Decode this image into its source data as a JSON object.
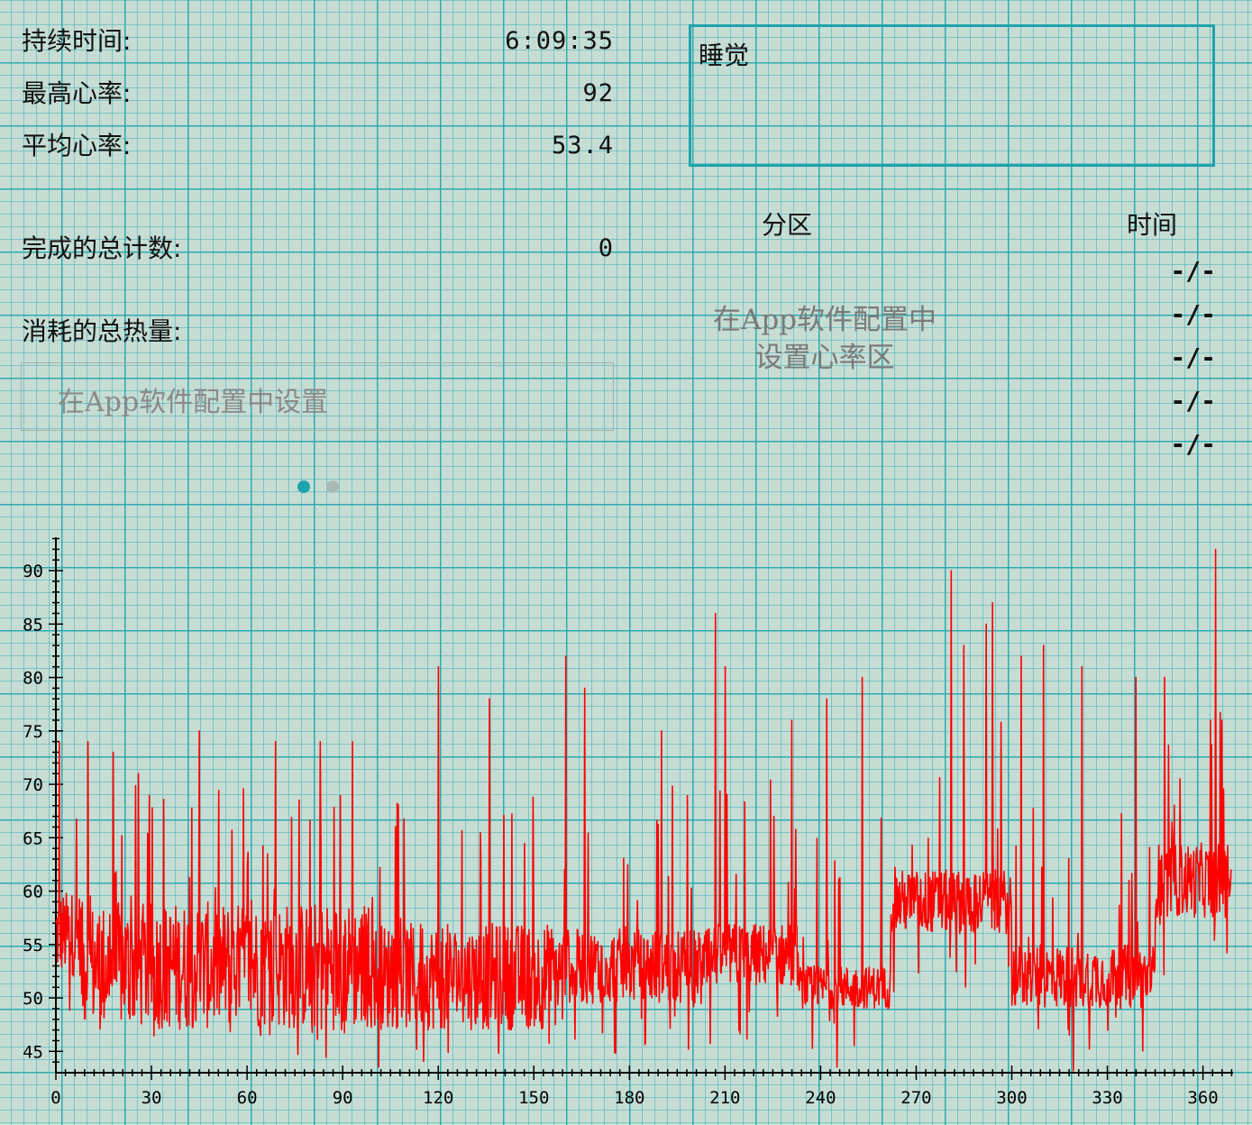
{
  "stats": {
    "duration_label": "持续时间:",
    "duration_value": "6:09:35",
    "max_hr_label": "最高心率:",
    "max_hr_value": "92",
    "avg_hr_label": "平均心率:",
    "avg_hr_value": "53.4",
    "total_count_label": "完成的总计数:",
    "total_count_value": "0",
    "calories_label": "消耗的总热量:"
  },
  "calories_config": {
    "text": "在App软件配置中设置"
  },
  "activity": {
    "mode": "睡觉"
  },
  "zones": {
    "header_zone": "分区",
    "header_time": "时间",
    "message_line1": "在App软件配置中",
    "message_line2": "设置心率区",
    "times": [
      "-/-",
      "-/-",
      "-/-",
      "-/-",
      "-/-"
    ]
  },
  "pager": {
    "pages": 2,
    "active": 0,
    "active_color": "#1fa3ad",
    "inactive_color": "#a9b9b3"
  },
  "chart_data": {
    "type": "line",
    "series": [
      {
        "color": "#ff0000",
        "x_range": [
          0,
          370
        ],
        "baseline": 53.4,
        "max": 92,
        "min": 43
      }
    ],
    "x_ticks": [
      0,
      30,
      60,
      90,
      120,
      150,
      180,
      210,
      240,
      270,
      300,
      330,
      360
    ],
    "y_ticks": [
      45,
      50,
      55,
      60,
      65,
      70,
      75,
      80,
      85,
      90
    ],
    "xlim": [
      0,
      370
    ],
    "ylim": [
      43,
      93
    ],
    "peaks": [
      [
        1,
        74
      ],
      [
        10,
        74
      ],
      [
        18,
        73
      ],
      [
        26,
        71
      ],
      [
        45,
        75
      ],
      [
        69,
        74
      ],
      [
        83,
        74
      ],
      [
        93,
        74
      ],
      [
        120,
        81
      ],
      [
        136,
        78
      ],
      [
        160,
        82
      ],
      [
        166,
        79
      ],
      [
        190,
        75
      ],
      [
        207,
        86
      ],
      [
        210,
        81
      ],
      [
        231,
        76
      ],
      [
        242,
        78
      ],
      [
        253,
        80
      ],
      [
        281,
        90
      ],
      [
        285,
        83
      ],
      [
        292,
        85
      ],
      [
        294,
        87
      ],
      [
        303,
        82
      ],
      [
        310,
        83
      ],
      [
        322,
        81
      ],
      [
        339,
        80
      ],
      [
        348,
        80
      ],
      [
        364,
        92
      ],
      [
        366,
        76
      ]
    ]
  }
}
